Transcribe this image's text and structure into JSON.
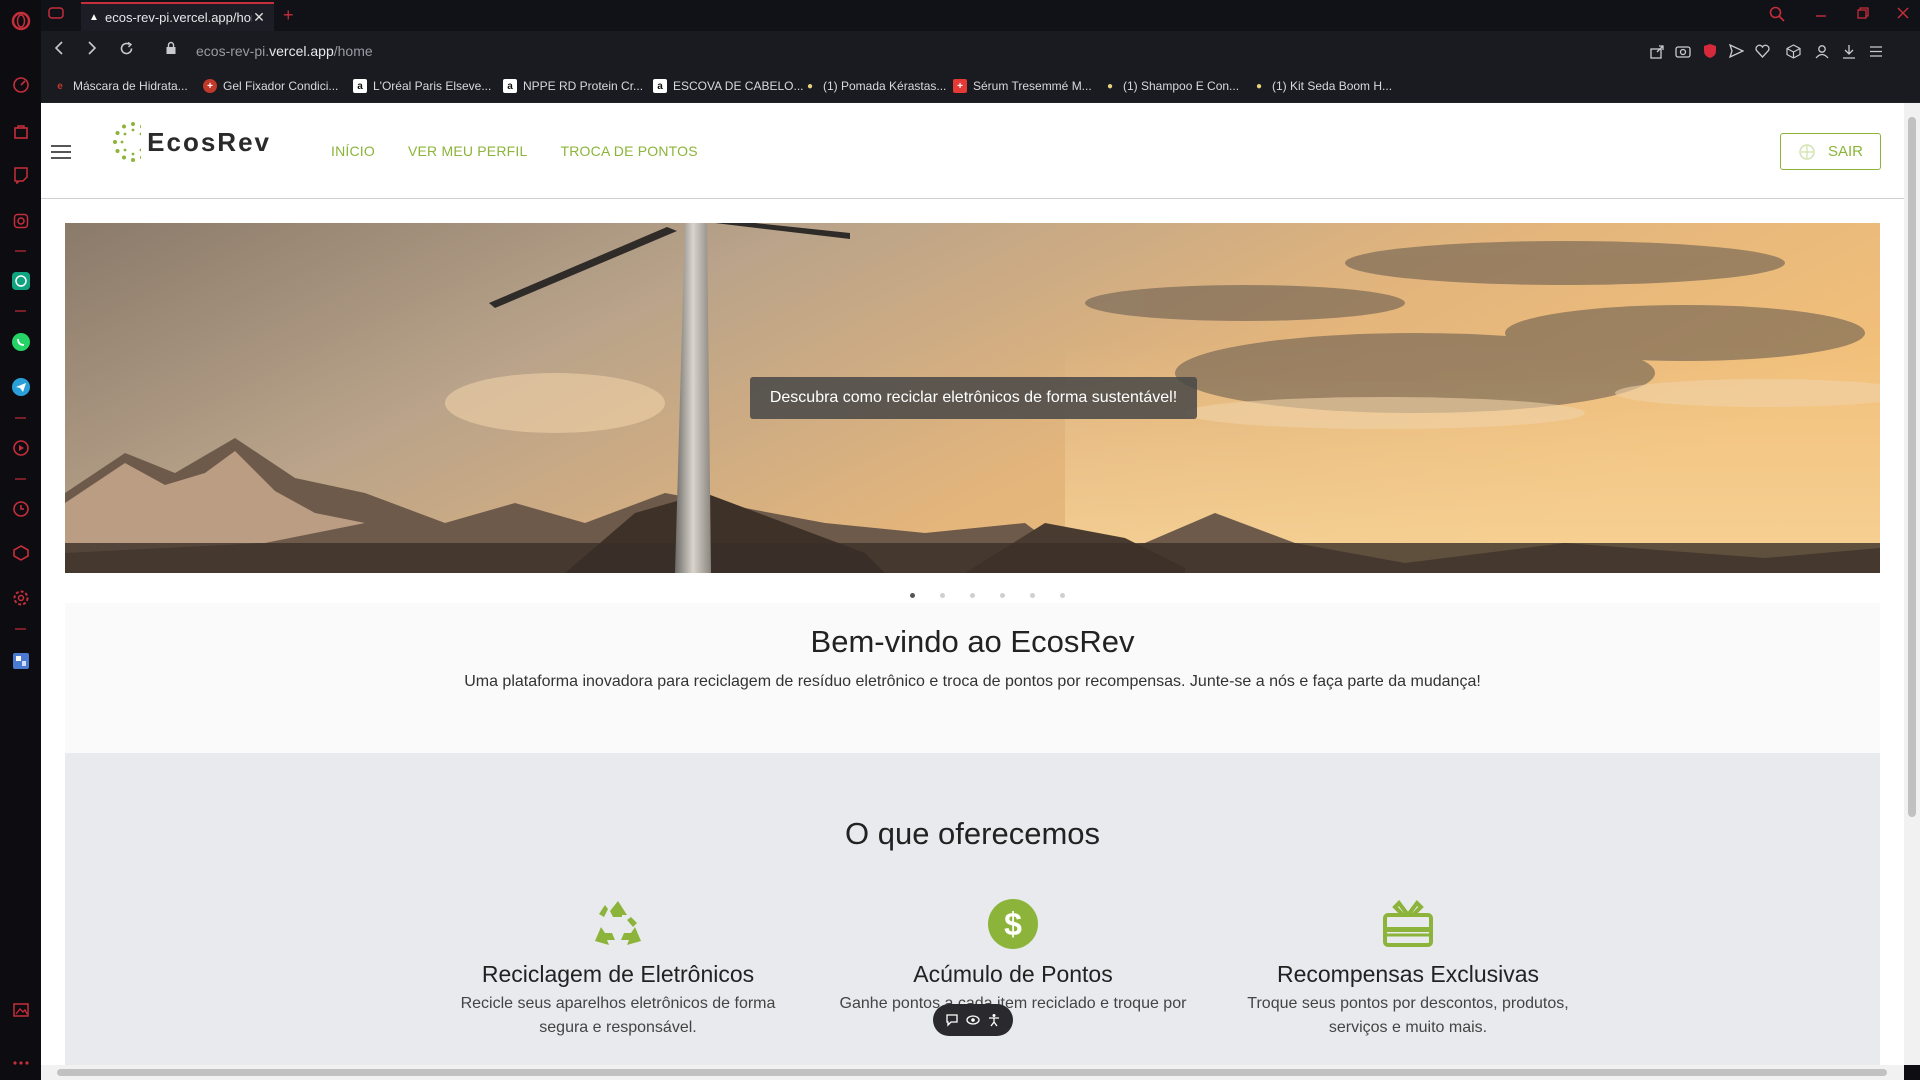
{
  "browser": {
    "tab": {
      "title": "ecos-rev-pi.vercel.app/hom",
      "close": "✕"
    },
    "new_tab": "+",
    "url_prefix": "ecos-rev-pi.",
    "url_host": "vercel.app",
    "url_path": "/home",
    "bookmarks": [
      {
        "label": "Máscara de Hidrata...",
        "icon": "e",
        "color": "#c0392b"
      },
      {
        "label": "Gel Fixador Condici...",
        "icon": "+",
        "color": "#c0392b"
      },
      {
        "label": "L'Oréal Paris Elseve...",
        "icon": "a",
        "color": "#ffffff"
      },
      {
        "label": "NPPE RD Protein Cr...",
        "icon": "a",
        "color": "#ffffff"
      },
      {
        "label": "ESCOVA DE CABELO...",
        "icon": "a",
        "color": "#ffffff"
      },
      {
        "label": "(1) Pomada Kérastas...",
        "icon": "●",
        "color": "#e8d27a"
      },
      {
        "label": "Sérum Tresemmé M...",
        "icon": "+",
        "color": "#e53935"
      },
      {
        "label": "(1) Shampoo E Con...",
        "icon": "●",
        "color": "#e8d27a"
      },
      {
        "label": "(1) Kit Seda Boom H...",
        "icon": "●",
        "color": "#e8d27a"
      }
    ]
  },
  "site": {
    "brand": "EcosRev",
    "nav": [
      "INÍCIO",
      "VER MEU PERFIL",
      "TROCA DE PONTOS"
    ],
    "logout": "SAIR",
    "accent": "#8cb43a",
    "hero_caption": "Descubra como reciclar eletrônicos de forma sustentável!",
    "carousel_slides": 6,
    "carousel_active": 1,
    "welcome_title": "Bem-vindo ao EcosRev",
    "welcome_text": "Uma plataforma inovadora para reciclagem de resíduo eletrônico e troca de pontos por recompensas. Junte-se a nós e faça parte da mudança!",
    "offers_title": "O que oferecemos",
    "offers": [
      {
        "icon": "recycle-icon",
        "title": "Reciclagem de Eletrônicos",
        "text": "Recicle seus aparelhos eletrônicos de forma segura e responsável."
      },
      {
        "icon": "dollar-icon",
        "title": "Acúmulo de Pontos",
        "text": "Ganhe pontos a cada item reciclado e troque por"
      },
      {
        "icon": "gift-icon",
        "title": "Recompensas Exclusivas",
        "text": "Troque seus pontos por descontos, produtos, serviços e muito mais."
      }
    ]
  }
}
